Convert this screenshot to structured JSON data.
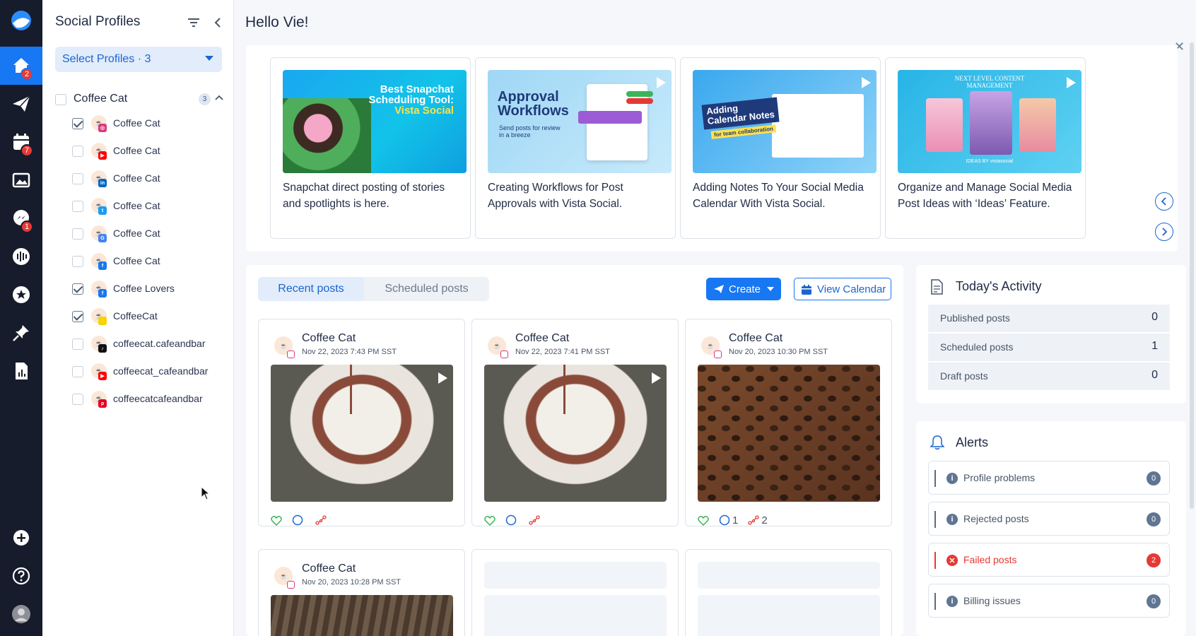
{
  "rail": {
    "badges": {
      "home": "2",
      "calendar": "7",
      "messages": "1"
    }
  },
  "profiles": {
    "title": "Social Profiles",
    "select_label": "Select Profiles · 3",
    "group": {
      "label": "Coffee Cat",
      "count": "3"
    },
    "items": [
      {
        "name": "Coffee Cat",
        "checked": true,
        "network": "instagram"
      },
      {
        "name": "Coffee Cat",
        "checked": false,
        "network": "youtube"
      },
      {
        "name": "Coffee Cat",
        "checked": false,
        "network": "linkedin"
      },
      {
        "name": "Coffee Cat",
        "checked": false,
        "network": "twitter"
      },
      {
        "name": "Coffee Cat",
        "checked": false,
        "network": "google-business"
      },
      {
        "name": "Coffee Cat",
        "checked": false,
        "network": "facebook"
      },
      {
        "name": "Coffee Lovers",
        "checked": true,
        "network": "facebook"
      },
      {
        "name": "CoffeeCat",
        "checked": true,
        "network": "snapchat"
      },
      {
        "name": "coffeecat.cafeandbar",
        "checked": false,
        "network": "tiktok"
      },
      {
        "name": "coffeecat_cafeandbar",
        "checked": false,
        "network": "youtube"
      },
      {
        "name": "coffeecatcafeandbar",
        "checked": false,
        "network": "pinterest"
      }
    ]
  },
  "main": {
    "greeting": "Hello Vie!"
  },
  "news": [
    {
      "text": "Snapchat direct posting of stories and spotlights is here.",
      "img_text_1": "Best Snapchat",
      "img_text_2": "Scheduling Tool:",
      "img_text_3": "Vista Social"
    },
    {
      "text": "Creating Workflows for Post Approvals with Vista Social.",
      "img_text_1": "Approval",
      "img_text_2": "Workflows",
      "img_text_3": "Send posts for review in a breeze"
    },
    {
      "text": "Adding Notes To Your Social Media Calendar With Vista Social.",
      "img_text_1": "Adding",
      "img_text_2": "Calendar Notes",
      "img_text_3": "for team collaboration"
    },
    {
      "text": "Organize and Manage Social Media Post Ideas with ‘Ideas’ Feature.",
      "img_text_1": "NEXT LEVEL CONTENT",
      "img_text_2": "MANAGEMENT",
      "img_text_3": "IDEAS BY vistasocial"
    }
  ],
  "posts": {
    "tabs": [
      "Recent posts",
      "Scheduled posts"
    ],
    "create_label": "Create",
    "calendar_label": "View Calendar",
    "items": [
      {
        "name": "Coffee Cat",
        "date": "Nov 22, 2023 7:43 PM SST",
        "comments": "",
        "shares": ""
      },
      {
        "name": "Coffee Cat",
        "date": "Nov 22, 2023 7:41 PM SST",
        "comments": "",
        "shares": ""
      },
      {
        "name": "Coffee Cat",
        "date": "Nov 20, 2023 10:30 PM SST",
        "comments": "1",
        "shares": "2"
      },
      {
        "name": "Coffee Cat",
        "date": "Nov 20, 2023 10:28 PM SST",
        "comments": "",
        "shares": ""
      }
    ]
  },
  "activity": {
    "title": "Today's Activity",
    "rows": [
      {
        "label": "Published posts",
        "value": "0"
      },
      {
        "label": "Scheduled posts",
        "value": "1"
      },
      {
        "label": "Draft posts",
        "value": "0"
      }
    ]
  },
  "alerts": {
    "title": "Alerts",
    "rows": [
      {
        "label": "Profile problems",
        "count": "0",
        "status": "info"
      },
      {
        "label": "Rejected posts",
        "count": "0",
        "status": "info"
      },
      {
        "label": "Failed posts",
        "count": "2",
        "status": "danger"
      },
      {
        "label": "Billing issues",
        "count": "0",
        "status": "info"
      }
    ]
  },
  "colors": {
    "accent": "#1877f2",
    "rail": "#161c2b",
    "danger": "#e53935"
  }
}
